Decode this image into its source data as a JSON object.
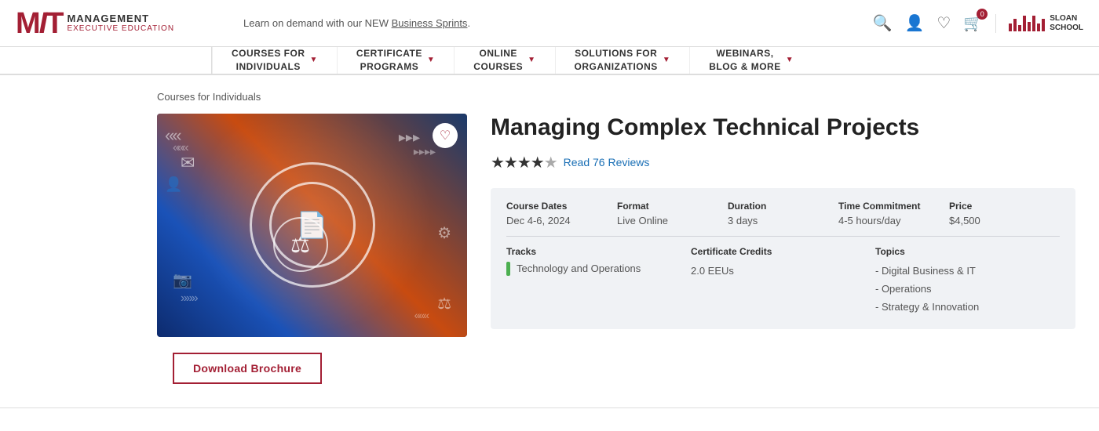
{
  "header": {
    "learn_text": "Learn on demand with our NEW ",
    "business_sprints": "Business Sprints",
    "learn_suffix": ".",
    "logo_mit": "MIT",
    "logo_management": "MANAGEMENT",
    "logo_exec": "EXECUTIVE EDUCATION",
    "sloan_line1": "SLOAN",
    "sloan_line2": "SCHOOL",
    "icons": {
      "search": "🔍",
      "person": "👤",
      "heart": "♡",
      "cart": "🛒",
      "cart_count": "0"
    }
  },
  "nav": {
    "items": [
      {
        "label": "COURSES FOR\nINDIVIDUALS",
        "has_chevron": true
      },
      {
        "label": "CERTIFICATE\nPROGRAMS",
        "has_chevron": true
      },
      {
        "label": "ONLINE\nCOURSES",
        "has_chevron": true
      },
      {
        "label": "SOLUTIONS FOR\nORGANIZATIONS",
        "has_chevron": true
      },
      {
        "label": "WEBINARS,\nBLOG & MORE",
        "has_chevron": true
      }
    ]
  },
  "breadcrumb": "Courses for Individuals",
  "course": {
    "title": "Managing Complex Technical Projects",
    "rating_stars": "★★★★½",
    "reviews_link": "Read 76 Reviews",
    "table": {
      "col_headers": [
        "Course Dates",
        "Format",
        "Duration",
        "Time Commitment",
        "Price"
      ],
      "row_values": [
        "Dec 4-6, 2024",
        "Live Online",
        "3 days",
        "4-5 hours/day",
        "$4,500"
      ]
    },
    "tracks_label": "Tracks",
    "tracks_value": "Technology and Operations",
    "credits_label": "Certificate Credits",
    "credits_value": "2.0 EEUs",
    "topics_label": "Topics",
    "topics": [
      "- Digital Business & IT",
      "- Operations",
      "- Strategy & Innovation"
    ]
  },
  "buttons": {
    "download_brochure": "Download Brochure",
    "heart": "♡"
  }
}
